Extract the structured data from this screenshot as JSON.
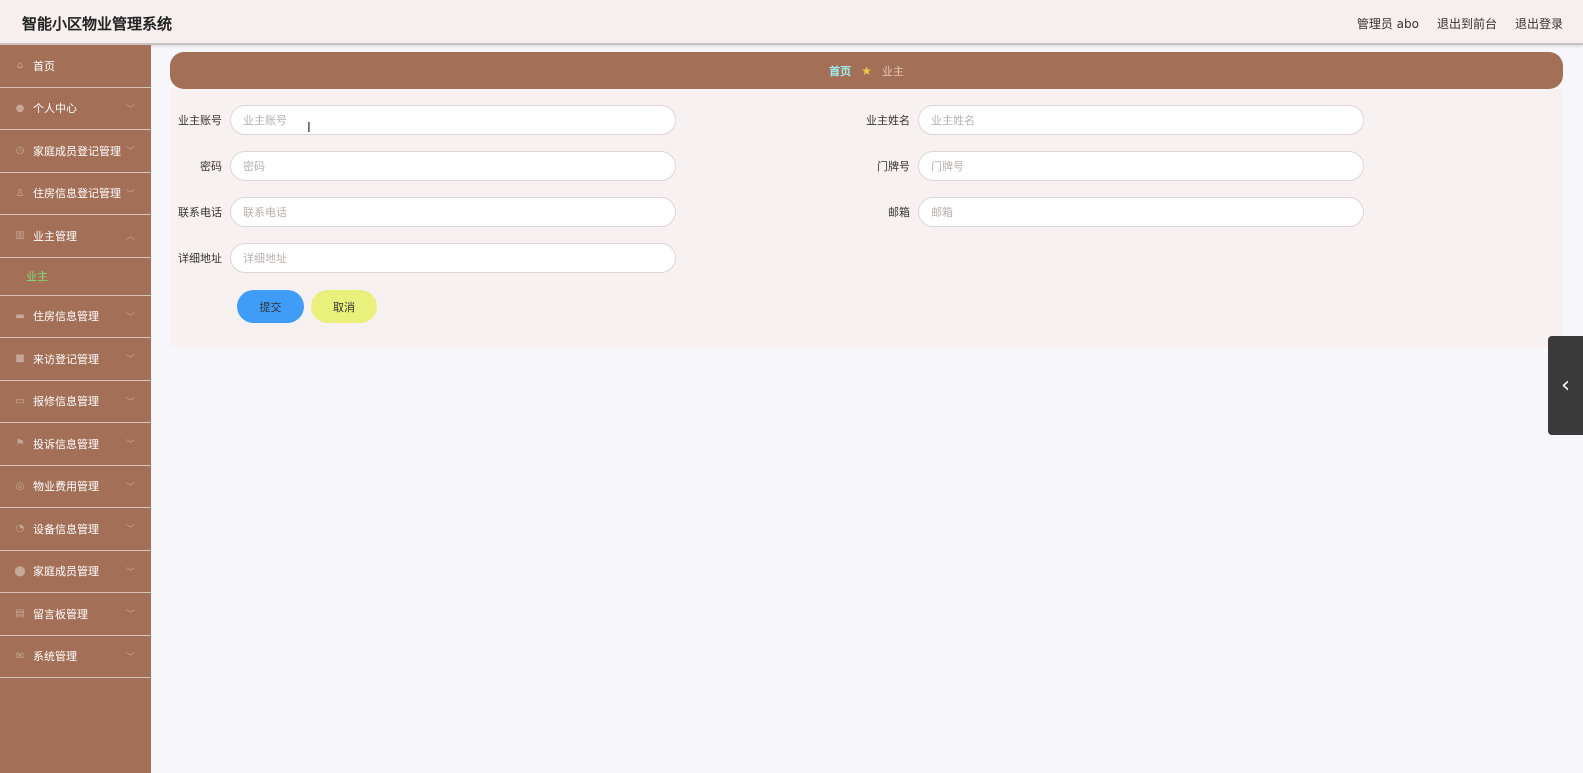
{
  "header": {
    "title": "智能小区物业管理系统",
    "user": "管理员 abo",
    "to_front": "退出到前台",
    "logout": "退出登录"
  },
  "sidebar": {
    "items": [
      {
        "label": "首页",
        "icon": "home-icon",
        "expandable": false
      },
      {
        "label": "个人中心",
        "icon": "user-icon",
        "expandable": true
      },
      {
        "label": "家庭成员登记管理",
        "icon": "clock-icon",
        "expandable": true
      },
      {
        "label": "住房信息登记管理",
        "icon": "person-outline-icon",
        "expandable": true
      },
      {
        "label": "业主管理",
        "icon": "chart-icon",
        "expandable": true,
        "expanded": true,
        "children": [
          {
            "label": "业主",
            "active": true
          }
        ]
      },
      {
        "label": "住房信息管理",
        "icon": "briefcase-icon",
        "expandable": true
      },
      {
        "label": "来访登记管理",
        "icon": "square-icon",
        "expandable": true
      },
      {
        "label": "报修信息管理",
        "icon": "ticket-icon",
        "expandable": true
      },
      {
        "label": "投诉信息管理",
        "icon": "flag-icon",
        "expandable": true
      },
      {
        "label": "物业费用管理",
        "icon": "globe-icon",
        "expandable": true
      },
      {
        "label": "设备信息管理",
        "icon": "gauge-icon",
        "expandable": true
      },
      {
        "label": "家庭成员管理",
        "icon": "location-icon",
        "expandable": true
      },
      {
        "label": "留言板管理",
        "icon": "document-icon",
        "expandable": true
      },
      {
        "label": "系统管理",
        "icon": "mail-icon",
        "expandable": true
      }
    ]
  },
  "breadcrumb": {
    "home": "首页",
    "current": "业主"
  },
  "form": {
    "account": {
      "label": "业主账号",
      "placeholder": "业主账号",
      "value": ""
    },
    "name": {
      "label": "业主姓名",
      "placeholder": "业主姓名",
      "value": ""
    },
    "password": {
      "label": "密码",
      "placeholder": "密码",
      "value": ""
    },
    "door": {
      "label": "门牌号",
      "placeholder": "门牌号",
      "value": ""
    },
    "phone": {
      "label": "联系电话",
      "placeholder": "联系电话",
      "value": ""
    },
    "email": {
      "label": "邮箱",
      "placeholder": "邮箱",
      "value": ""
    },
    "address": {
      "label": "详细地址",
      "placeholder": "详细地址",
      "value": ""
    },
    "submit": "提交",
    "cancel": "取消"
  },
  "colors": {
    "sidebar": "#a36f56",
    "header": "#f7eeee",
    "submit": "#3f9df8",
    "cancel": "#eaf07c",
    "active_sub": "#7de07a"
  }
}
